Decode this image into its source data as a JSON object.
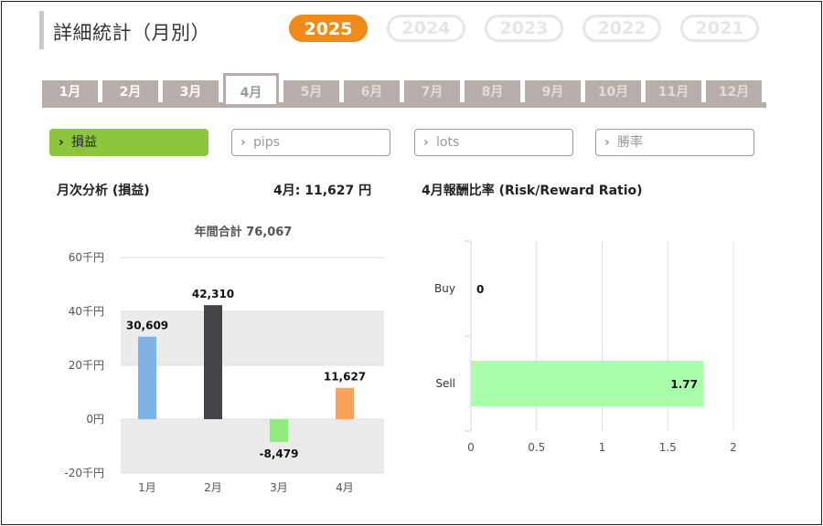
{
  "page_title": "詳細統計（月別）",
  "years": [
    {
      "label": "2025",
      "active": true
    },
    {
      "label": "2024",
      "active": false
    },
    {
      "label": "2023",
      "active": false
    },
    {
      "label": "2022",
      "active": false
    },
    {
      "label": "2021",
      "active": false
    }
  ],
  "months": [
    "1月",
    "2月",
    "3月",
    "4月",
    "5月",
    "6月",
    "7月",
    "8月",
    "9月",
    "10月",
    "11月",
    "12月"
  ],
  "active_month_index": 3,
  "filters": [
    {
      "label": "損益",
      "active": true
    },
    {
      "label": "pips",
      "active": false
    },
    {
      "label": "lots",
      "active": false
    },
    {
      "label": "勝率",
      "active": false
    }
  ],
  "analysis": {
    "title": "月次分析 (損益)",
    "month_value": "4月:  11,627 円",
    "ratio_title": "4月報酬比率 (Risk/Reward Ratio)"
  },
  "colors": {
    "accent": "#f08b1b",
    "active_filter": "#8cc63f",
    "tab": "#b7aeac",
    "bar_jan": "#7fb2e5",
    "bar_feb": "#434348",
    "bar_mar": "#90ed7d",
    "bar_apr": "#f7a35c",
    "bar_sell": "#aaffaa"
  },
  "chart_data": [
    {
      "type": "bar",
      "title": "年間合計 76,067",
      "categories": [
        "1月",
        "2月",
        "3月",
        "4月"
      ],
      "values": [
        30609,
        42310,
        -8479,
        11627
      ],
      "value_labels": [
        "30,609",
        "42,310",
        "-8,479",
        "11,627"
      ],
      "ylim": [
        -20000,
        60000
      ],
      "yticks": [
        60000,
        40000,
        20000,
        0,
        -20000
      ],
      "ytick_labels": [
        "60千円",
        "40千円",
        "20千円",
        "0円",
        "-20千円"
      ],
      "grid": true
    },
    {
      "type": "bar",
      "orientation": "horizontal",
      "categories": [
        "Buy",
        "Sell"
      ],
      "values": [
        0,
        1.77
      ],
      "value_labels": [
        "0",
        "1.77"
      ],
      "xlim": [
        0,
        2
      ],
      "xticks": [
        0,
        0.5,
        1,
        1.5,
        2
      ],
      "xtick_labels": [
        "0",
        "0.5",
        "1",
        "1.5",
        "2"
      ],
      "grid": true
    }
  ]
}
